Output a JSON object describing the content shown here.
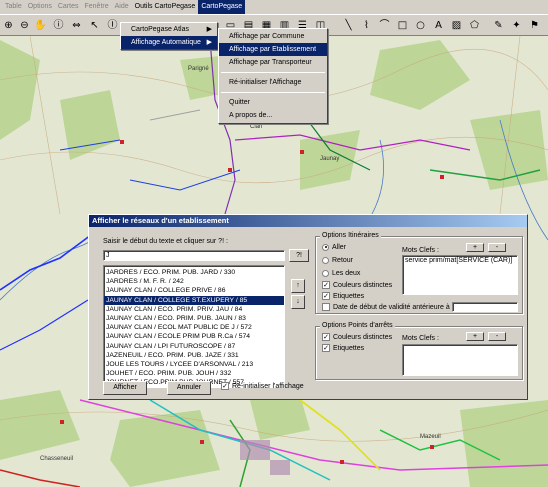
{
  "menubar": {
    "items": [
      {
        "label": "Table",
        "enabled": false
      },
      {
        "label": "Options",
        "enabled": false
      },
      {
        "label": "Cartes",
        "enabled": false
      },
      {
        "label": "Fenêtre",
        "enabled": false
      },
      {
        "label": "Aide",
        "enabled": false
      },
      {
        "label": "Outils CartoPegase",
        "enabled": true
      },
      {
        "label": "CartoPegase",
        "enabled": true,
        "active": true
      }
    ]
  },
  "cartopegase_menu": {
    "items": [
      {
        "label": "CartoPegase Atlas",
        "submenu": true
      },
      {
        "label": "Affichage Automatique",
        "submenu": true,
        "highlighted": true
      }
    ]
  },
  "affichage_submenu": {
    "items": [
      {
        "label": "Affichage par Commune"
      },
      {
        "label": "Affichage par Etablissement",
        "highlighted": true
      },
      {
        "label": "Affichage par Transporteur"
      },
      {
        "separator": true
      },
      {
        "label": "Ré-initialiser l'Affichage"
      },
      {
        "separator": true
      },
      {
        "label": "Quitter"
      },
      {
        "label": "A propos de..."
      }
    ]
  },
  "map_labels": {
    "l1": "Parigné",
    "l2": "Clan",
    "l3": "Jaunay",
    "l4": "Mazeuil",
    "l5": "Chasseneuil"
  },
  "dialog": {
    "title": "Afficher le réseaux d'un etablissement",
    "search_prompt": "Saisir le début du texte et cliquer sur ?! :",
    "search_value": "J",
    "search_button": "?!",
    "list_items": [
      "JARDRES / ECO. PRIM. PUB. JARD / 330",
      "JARDRES / M. F. R. / 242",
      "JAUNAY CLAN / COLLEGE PRIVE / 86",
      "JAUNAY CLAN / COLLEGE ST.EXUPERY / 85",
      "JAUNAY CLAN / ECO. PRIM. PRIV. JAU / 84",
      "JAUNAY CLAN / ECO. PRIM. PUB. JAUN / 83",
      "JAUNAY CLAN / ECOL MAT PUBLIC DE J / 572",
      "JAUNAY CLAN / ECOLE PRIM PUB  R.Ca / 574",
      "JAUNAY CLAN / LPI FUTUROSCOPE / 87",
      "JAZENEUIL / ECO. PRIM. PUB. JAZE / 331",
      "JOUE LES TOURS / LYCEE D'ARSONVAL / 213",
      "JOUHET / ECO. PRIM. PUB. JOUH / 332",
      "JOURNET / ECO.PRIM PUB JOURNET / 557"
    ],
    "selected_index": 3,
    "scroll_up": "↑",
    "scroll_down": "↓",
    "afficher_button": "Afficher",
    "annuler_button": "Annuler",
    "reinit_label": "Ré-initialiser l'affichage",
    "reinit_checked": true,
    "options_itineraires": {
      "legend": "Options Itinéraires",
      "radio_aller": "Aller",
      "radio_retour": "Retour",
      "radio_deux": "Les deux",
      "selected": "Aller",
      "couleurs": "Couleurs distinctes",
      "couleurs_checked": true,
      "etiquettes": "Etiquettes",
      "etiquettes_checked": true,
      "date_label": "Date de début de validité antérieure à",
      "date_checked": false,
      "mots_clefs": "Mots Clefs :",
      "mots_value": "service prim/mat[SERVICE  (CAR)]",
      "plus": "+",
      "minus": "-"
    },
    "options_points": {
      "legend": "Options Points d'arrêts",
      "couleurs": "Couleurs distinctes",
      "couleurs_checked": true,
      "etiquettes": "Etiquettes",
      "etiquettes_checked": true,
      "mots_clefs": "Mots Clefs :",
      "plus": "+",
      "minus": "-"
    }
  }
}
